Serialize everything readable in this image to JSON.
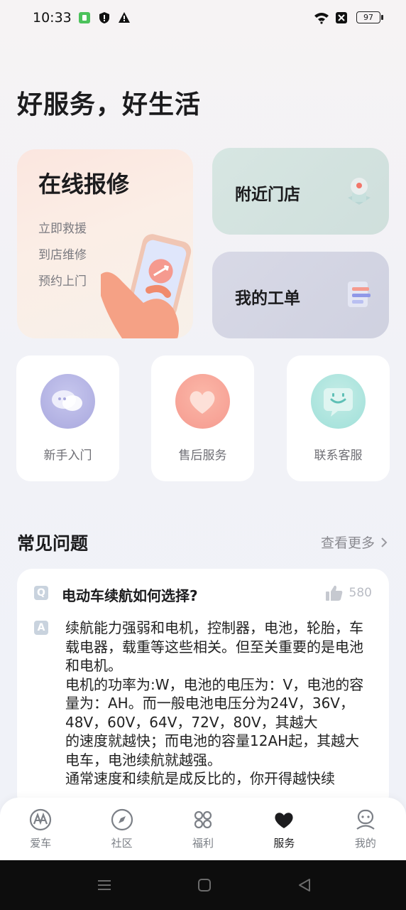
{
  "status_bar": {
    "time": "10:33",
    "battery": "97"
  },
  "page_title": "好服务，好生活",
  "repair_card": {
    "title": "在线报修",
    "items": [
      "立即救援",
      "到店维修",
      "预约上门"
    ]
  },
  "nearby_stores": {
    "label": "附近门店"
  },
  "my_orders": {
    "label": "我的工单"
  },
  "quick_tiles": [
    {
      "label": "新手入门",
      "icon": "chat-bubbles-icon"
    },
    {
      "label": "售后服务",
      "icon": "heart-icon"
    },
    {
      "label": "联系客服",
      "icon": "smile-message-icon"
    }
  ],
  "faq": {
    "title": "常见问题",
    "more": "查看更多",
    "question": "电动车续航如何选择?",
    "q_badge": "Q",
    "a_badge": "A",
    "likes": "580",
    "answer": "续航能力强弱和电机，控制器，电池，轮胎，车载电器，载重等这些相关。但至关重要的是电池和电机。\n电机的功率为:W，电池的电压为：V，电池的容量为：AH。而一般电池电压分为24V，36V，48V，60V，64V，72V，80V，其越大\n的速度就越快；而电池的容量12AH起，其越大电车，电池续航就越强。\n通常速度和续航是成反比的，你开得越快续"
  },
  "tab_bar": [
    {
      "label": "爱车",
      "icon": "car-logo-icon",
      "active": false
    },
    {
      "label": "社区",
      "icon": "compass-icon",
      "active": false
    },
    {
      "label": "福利",
      "icon": "grid-icon",
      "active": false
    },
    {
      "label": "服务",
      "icon": "heart-filled-icon",
      "active": true
    },
    {
      "label": "我的",
      "icon": "profile-icon",
      "active": false
    }
  ],
  "colors": {
    "accent": "#1c1c1e",
    "heart_tile": "#f59a8f",
    "chat_tile": "#b9b8e6",
    "service_tile": "#9fe0d9"
  }
}
